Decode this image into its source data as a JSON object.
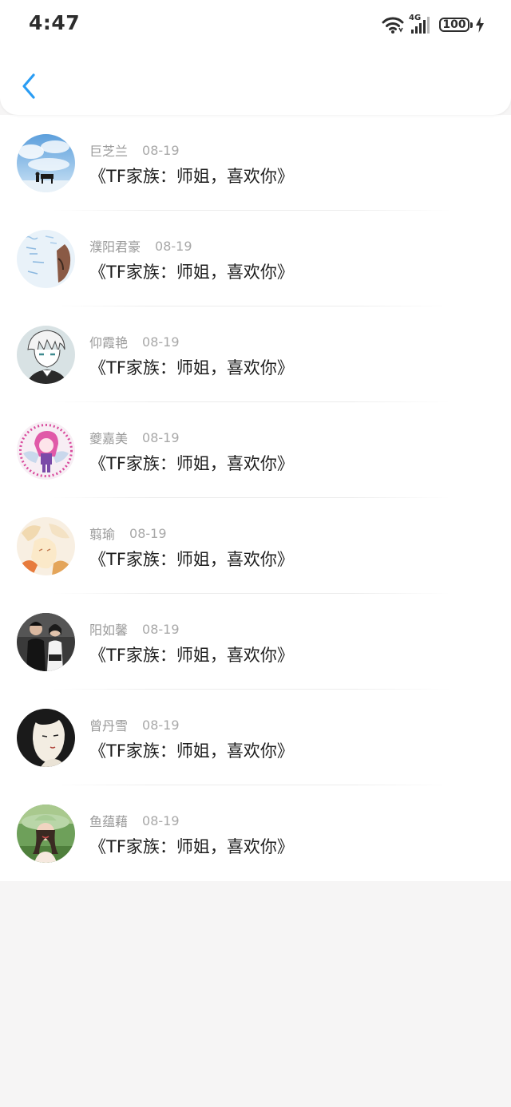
{
  "status_bar": {
    "time": "4:47",
    "network": "4G",
    "battery": "100"
  },
  "colors": {
    "accent": "#2a9df4",
    "name_text": "#9a9a9a",
    "title_text": "#1e1e1e",
    "background": "#f6f5f5"
  },
  "header": {
    "back_icon": "chevron-left-icon"
  },
  "items": [
    {
      "name": "巨芝兰",
      "date": "08-19",
      "title": "《TF家族：师姐，喜欢你》",
      "avatar": "sky-piano-avatar"
    },
    {
      "name": "濮阳君豪",
      "date": "08-19",
      "title": "《TF家族：师姐，喜欢你》",
      "avatar": "light-blue-illustration-avatar"
    },
    {
      "name": "仰霞艳",
      "date": "08-19",
      "title": "《TF家族：师姐，喜欢你》",
      "avatar": "anime-boy-avatar"
    },
    {
      "name": "夔嘉美",
      "date": "08-19",
      "title": "《TF家族：师姐，喜欢你》",
      "avatar": "pink-anime-girl-avatar"
    },
    {
      "name": "翦瑜",
      "date": "08-19",
      "title": "《TF家族：师姐，喜欢你》",
      "avatar": "pastel-illustration-avatar"
    },
    {
      "name": "阳如馨",
      "date": "08-19",
      "title": "《TF家族：师姐，喜欢你》",
      "avatar": "couple-photo-avatar"
    },
    {
      "name": "曾丹雪",
      "date": "08-19",
      "title": "《TF家族：师姐，喜欢你》",
      "avatar": "ink-portrait-avatar"
    },
    {
      "name": "鱼蕴藉",
      "date": "08-19",
      "title": "《TF家族：师姐，喜欢你》",
      "avatar": "girl-in-hat-photo-avatar"
    }
  ]
}
